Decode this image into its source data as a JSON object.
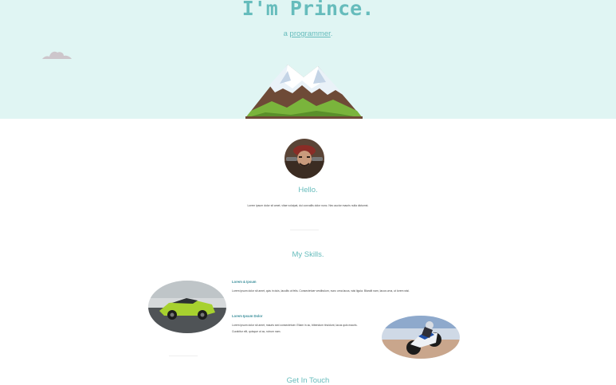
{
  "hero": {
    "title": "I'm Prince.",
    "subtitle_prefix": "a ",
    "subtitle_keyword": "programmer",
    "subtitle_suffix": ".",
    "background": "#e0f5f3",
    "accent": "#66bcbc"
  },
  "about": {
    "heading": "Hello.",
    "text": "Lorem ipsum dolor sit amet, vitae volutpat, dui convallis dolor nunc. Nec auctor mauris nulla dictumst."
  },
  "skills": {
    "heading": "My Skills.",
    "items": [
      {
        "title": "Lorem & Ipsum",
        "description": "Lorem ipsum dolor sit amet, quis in duis, lacullis ut felis. Consectetuer vestibulum, nunc urna lacus, wisi ligula. Blandit nam, lacus urna, ut lorem wisi.",
        "image": "green-race-car"
      },
      {
        "title": "Lorem Ipsum Dolor",
        "description_line1": "Lorem ipsum dolor sit amet, mauris sed consectetuer. Etiam in ac, bibendum tincidunt, lacus quis mauris.",
        "description_line2": "Curabitur elit, quisque ut ac, rutrum nam.",
        "image": "sport-motorbike"
      }
    ]
  },
  "contact": {
    "heading": "Get In Touch"
  }
}
